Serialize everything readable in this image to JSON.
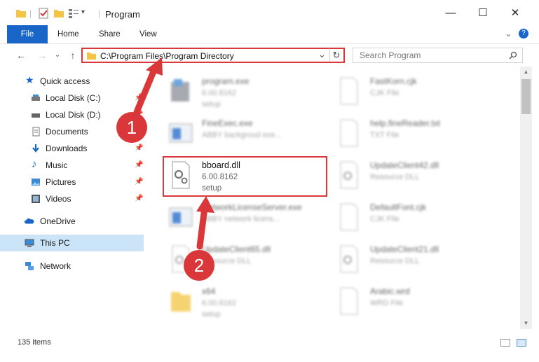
{
  "window": {
    "title": "Program",
    "minimize": "—",
    "maximize": "☐",
    "close": "✕"
  },
  "ribbon": {
    "tabs": [
      "File",
      "Home",
      "Share",
      "View"
    ],
    "collapse": "⌄",
    "help": "?"
  },
  "nav": {
    "back": "←",
    "forward": "→",
    "recent": "⌄",
    "up": "↑"
  },
  "address": {
    "path": "C:\\Program Files\\Program Directory",
    "dropdown": "⌄",
    "refresh": "↻"
  },
  "search": {
    "placeholder": "Search Program"
  },
  "sidebar": {
    "items": [
      {
        "label": "Quick access",
        "icon": "star-icon"
      },
      {
        "label": "Local Disk (C:)",
        "icon": "drive-icon",
        "pinned": true
      },
      {
        "label": "Local Disk (D:)",
        "icon": "drive-icon",
        "pinned": true
      },
      {
        "label": "Documents",
        "icon": "documents-icon",
        "pinned": true
      },
      {
        "label": "Downloads",
        "icon": "download-icon",
        "pinned": true
      },
      {
        "label": "Music",
        "icon": "music-icon",
        "pinned": true
      },
      {
        "label": "Pictures",
        "icon": "pictures-icon",
        "pinned": true
      },
      {
        "label": "Videos",
        "icon": "videos-icon",
        "pinned": true
      },
      {
        "label": "OneDrive",
        "icon": "cloud-icon"
      },
      {
        "label": "This PC",
        "icon": "computer-icon",
        "selected": true
      },
      {
        "label": "Network",
        "icon": "network-icon"
      }
    ]
  },
  "files": [
    {
      "name": "program.exe",
      "line1": "6.00.8162",
      "line2": "setup"
    },
    {
      "name": "FastKorn.cjk",
      "line1": "CJK File",
      "line2": ""
    },
    {
      "name": "FineExec.exe",
      "line1": "ABBY backgroud exe...",
      "line2": ""
    },
    {
      "name": "help.fineReader.txt",
      "line1": "TXT File",
      "line2": ""
    },
    {
      "name": "bboard.dll",
      "line1": "6.00.8162",
      "line2": "setup"
    },
    {
      "name": "UpdateClient42.dll",
      "line1": "Resource DLL",
      "line2": ""
    },
    {
      "name": "NetworkLicenseServer.exe",
      "line1": "ABBY network licens...",
      "line2": ""
    },
    {
      "name": "DefaultFont.cjk",
      "line1": "CJK File",
      "line2": ""
    },
    {
      "name": "UpdateClient65.dll",
      "line1": "Resource DLL",
      "line2": ""
    },
    {
      "name": "UpdateClient21.dll",
      "line1": "Resource DLL",
      "line2": ""
    },
    {
      "name": "x64",
      "line1": "6.00.8162",
      "line2": "setup"
    },
    {
      "name": "Arabic.wrd",
      "line1": "WRD File",
      "line2": ""
    }
  ],
  "status": {
    "item_count": "135 items"
  },
  "annotations": [
    {
      "label": "1"
    },
    {
      "label": "2"
    }
  ],
  "colors": {
    "accent": "#1a66c8",
    "highlight": "#d9373a",
    "selected": "#cce4f7"
  }
}
